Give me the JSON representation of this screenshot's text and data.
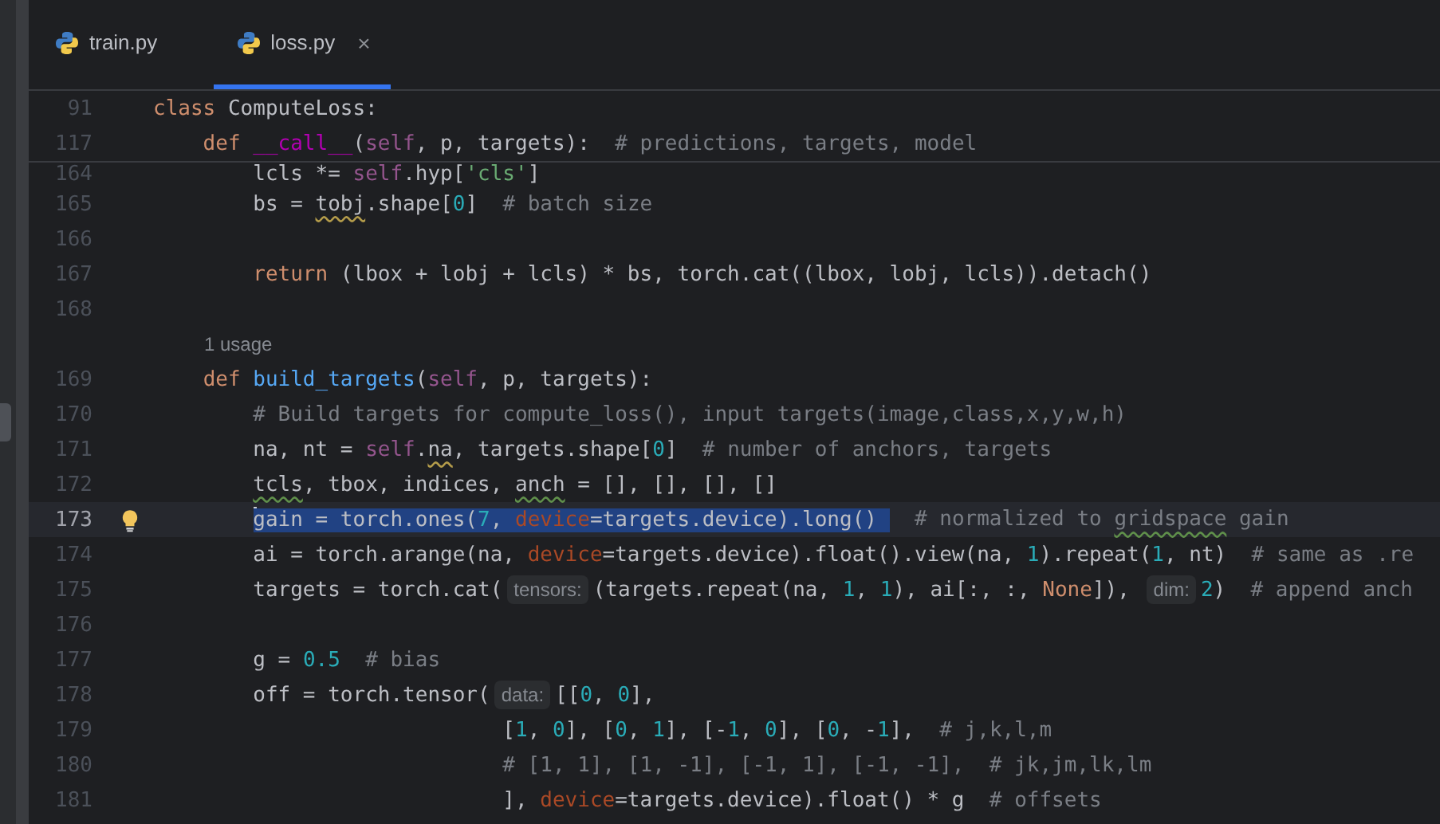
{
  "tabs": [
    {
      "label": "train.py",
      "selected": false,
      "closable": false
    },
    {
      "label": "loss.py",
      "selected": true,
      "closable": true,
      "close": "×"
    }
  ],
  "sticky_lines": [
    {
      "number": "91",
      "tokens": [
        {
          "kind": "kw",
          "text": "class "
        },
        {
          "kind": "plain",
          "text": "ComputeLoss:"
        }
      ]
    },
    {
      "number": "117",
      "tokens": [
        {
          "kind": "kw",
          "text": "    def "
        },
        {
          "kind": "magic",
          "text": "__call__"
        },
        {
          "kind": "plain",
          "text": "("
        },
        {
          "kind": "self",
          "text": "self"
        },
        {
          "kind": "plain",
          "text": ", p, targets):  "
        },
        {
          "kind": "cmt",
          "text": "# predictions, targets, model"
        }
      ]
    }
  ],
  "lines": [
    {
      "kind": "code",
      "number": "164",
      "partial": true,
      "tokens": [
        {
          "kind": "plain",
          "text": "        lcls *= "
        },
        {
          "kind": "self",
          "text": "self"
        },
        {
          "kind": "plain",
          "text": ".hyp["
        },
        {
          "kind": "str",
          "text": "'cls'"
        },
        {
          "kind": "plain",
          "text": "]"
        }
      ]
    },
    {
      "kind": "code",
      "number": "165",
      "tokens": [
        {
          "kind": "plain",
          "text": "        bs = "
        },
        {
          "kind": "warn",
          "text": "tobj"
        },
        {
          "kind": "plain",
          "text": ".shape["
        },
        {
          "kind": "num",
          "text": "0"
        },
        {
          "kind": "plain",
          "text": "]  "
        },
        {
          "kind": "cmt",
          "text": "# batch size"
        }
      ]
    },
    {
      "kind": "code",
      "number": "166"
    },
    {
      "kind": "code",
      "number": "167",
      "tokens": [
        {
          "kind": "kw",
          "text": "        return "
        },
        {
          "kind": "plain",
          "text": "(lbox + lobj + lcls) * bs, torch.cat((lbox, lobj, lcls)).detach()"
        }
      ]
    },
    {
      "kind": "code",
      "number": "168"
    },
    {
      "kind": "usage",
      "text": "1 usage"
    },
    {
      "kind": "code",
      "number": "169",
      "tokens": [
        {
          "kind": "kw",
          "text": "    def "
        },
        {
          "kind": "fn",
          "text": "build_targets"
        },
        {
          "kind": "plain",
          "text": "("
        },
        {
          "kind": "self",
          "text": "self"
        },
        {
          "kind": "plain",
          "text": ", p, targets):"
        }
      ]
    },
    {
      "kind": "code",
      "number": "170",
      "tokens": [
        {
          "kind": "cmt",
          "text": "        # Build targets for compute_loss(), input targets(image,class,x,y,w,h)"
        }
      ]
    },
    {
      "kind": "code",
      "number": "171",
      "tokens": [
        {
          "kind": "plain",
          "text": "        na, nt = "
        },
        {
          "kind": "self",
          "text": "self"
        },
        {
          "kind": "plain",
          "text": "."
        },
        {
          "kind": "warn",
          "text": "na"
        },
        {
          "kind": "plain",
          "text": ", targets.shape["
        },
        {
          "kind": "num",
          "text": "0"
        },
        {
          "kind": "plain",
          "text": "]  "
        },
        {
          "kind": "cmt",
          "text": "# number of anchors, targets"
        }
      ]
    },
    {
      "kind": "code",
      "number": "172",
      "tokens": [
        {
          "kind": "typo",
          "text": "        tcls"
        },
        {
          "kind": "plain",
          "text": ", tbox, indices, "
        },
        {
          "kind": "typo",
          "text": "anch"
        },
        {
          "kind": "plain",
          "text": " = [], [], [], []"
        }
      ]
    },
    {
      "kind": "code",
      "number": "173",
      "current": true,
      "bulb": true,
      "tokens": [
        {
          "kind": "plain",
          "text": "        gain = torch.ones(",
          "selected": true
        },
        {
          "kind": "num",
          "text": "7",
          "selected": true
        },
        {
          "kind": "plain",
          "text": ", ",
          "selected": true
        },
        {
          "kind": "param",
          "text": "device",
          "selected": true
        },
        {
          "kind": "plain",
          "text": "=targets.device).long() ",
          "selected": true
        },
        {
          "kind": "cmt",
          "text": "  # normalized to ",
          "selected": false
        },
        {
          "kind": "typo-cmt",
          "text": "gridspace",
          "selected": false
        },
        {
          "kind": "cmt",
          "text": " gain",
          "selected": false
        }
      ]
    },
    {
      "kind": "code",
      "number": "174",
      "tokens": [
        {
          "kind": "plain",
          "text": "        ai = torch.arange(na, "
        },
        {
          "kind": "param",
          "text": "device"
        },
        {
          "kind": "plain",
          "text": "=targets.device).float().view(na, "
        },
        {
          "kind": "num",
          "text": "1"
        },
        {
          "kind": "plain",
          "text": ").repeat("
        },
        {
          "kind": "num",
          "text": "1"
        },
        {
          "kind": "plain",
          "text": ", nt)  "
        },
        {
          "kind": "cmt",
          "text": "# same as .re"
        }
      ]
    },
    {
      "kind": "code",
      "number": "175",
      "tokens": [
        {
          "kind": "plain",
          "text": "        targets = torch.cat("
        },
        {
          "kind": "hint",
          "text": "tensors:"
        },
        {
          "kind": "plain",
          "text": "(targets.repeat(na, "
        },
        {
          "kind": "num",
          "text": "1"
        },
        {
          "kind": "plain",
          "text": ", "
        },
        {
          "kind": "num",
          "text": "1"
        },
        {
          "kind": "plain",
          "text": "), ai[:, :, "
        },
        {
          "kind": "kw",
          "text": "None"
        },
        {
          "kind": "plain",
          "text": "]), "
        },
        {
          "kind": "hint",
          "text": "dim:"
        },
        {
          "kind": "num",
          "text": "2"
        },
        {
          "kind": "plain",
          "text": ")  "
        },
        {
          "kind": "cmt",
          "text": "# append anch"
        }
      ]
    },
    {
      "kind": "code",
      "number": "176"
    },
    {
      "kind": "code",
      "number": "177",
      "tokens": [
        {
          "kind": "plain",
          "text": "        g = "
        },
        {
          "kind": "num",
          "text": "0.5"
        },
        {
          "kind": "cmt",
          "text": "  # bias"
        }
      ]
    },
    {
      "kind": "code",
      "number": "178",
      "tokens": [
        {
          "kind": "plain",
          "text": "        off = torch.tensor("
        },
        {
          "kind": "hint",
          "text": "data:"
        },
        {
          "kind": "plain",
          "text": "[["
        },
        {
          "kind": "num",
          "text": "0"
        },
        {
          "kind": "plain",
          "text": ", "
        },
        {
          "kind": "num",
          "text": "0"
        },
        {
          "kind": "plain",
          "text": "],"
        }
      ]
    },
    {
      "kind": "code",
      "number": "179",
      "tokens": [
        {
          "kind": "plain",
          "text": "                            ["
        },
        {
          "kind": "num",
          "text": "1"
        },
        {
          "kind": "plain",
          "text": ", "
        },
        {
          "kind": "num",
          "text": "0"
        },
        {
          "kind": "plain",
          "text": "], ["
        },
        {
          "kind": "num",
          "text": "0"
        },
        {
          "kind": "plain",
          "text": ", "
        },
        {
          "kind": "num",
          "text": "1"
        },
        {
          "kind": "plain",
          "text": "], [-"
        },
        {
          "kind": "num",
          "text": "1"
        },
        {
          "kind": "plain",
          "text": ", "
        },
        {
          "kind": "num",
          "text": "0"
        },
        {
          "kind": "plain",
          "text": "], ["
        },
        {
          "kind": "num",
          "text": "0"
        },
        {
          "kind": "plain",
          "text": ", -"
        },
        {
          "kind": "num",
          "text": "1"
        },
        {
          "kind": "plain",
          "text": "],  "
        },
        {
          "kind": "cmt",
          "text": "# j,k,l,m"
        }
      ]
    },
    {
      "kind": "code",
      "number": "180",
      "tokens": [
        {
          "kind": "cmt",
          "text": "                            # [1, 1], [1, -1], [-1, 1], [-1, -1],  # jk,jm,lk,lm"
        }
      ]
    },
    {
      "kind": "code",
      "number": "181",
      "tokens": [
        {
          "kind": "plain",
          "text": "                            ], "
        },
        {
          "kind": "param",
          "text": "device"
        },
        {
          "kind": "plain",
          "text": "=targets.device).float() * g  "
        },
        {
          "kind": "cmt",
          "text": "# offsets"
        }
      ]
    }
  ]
}
